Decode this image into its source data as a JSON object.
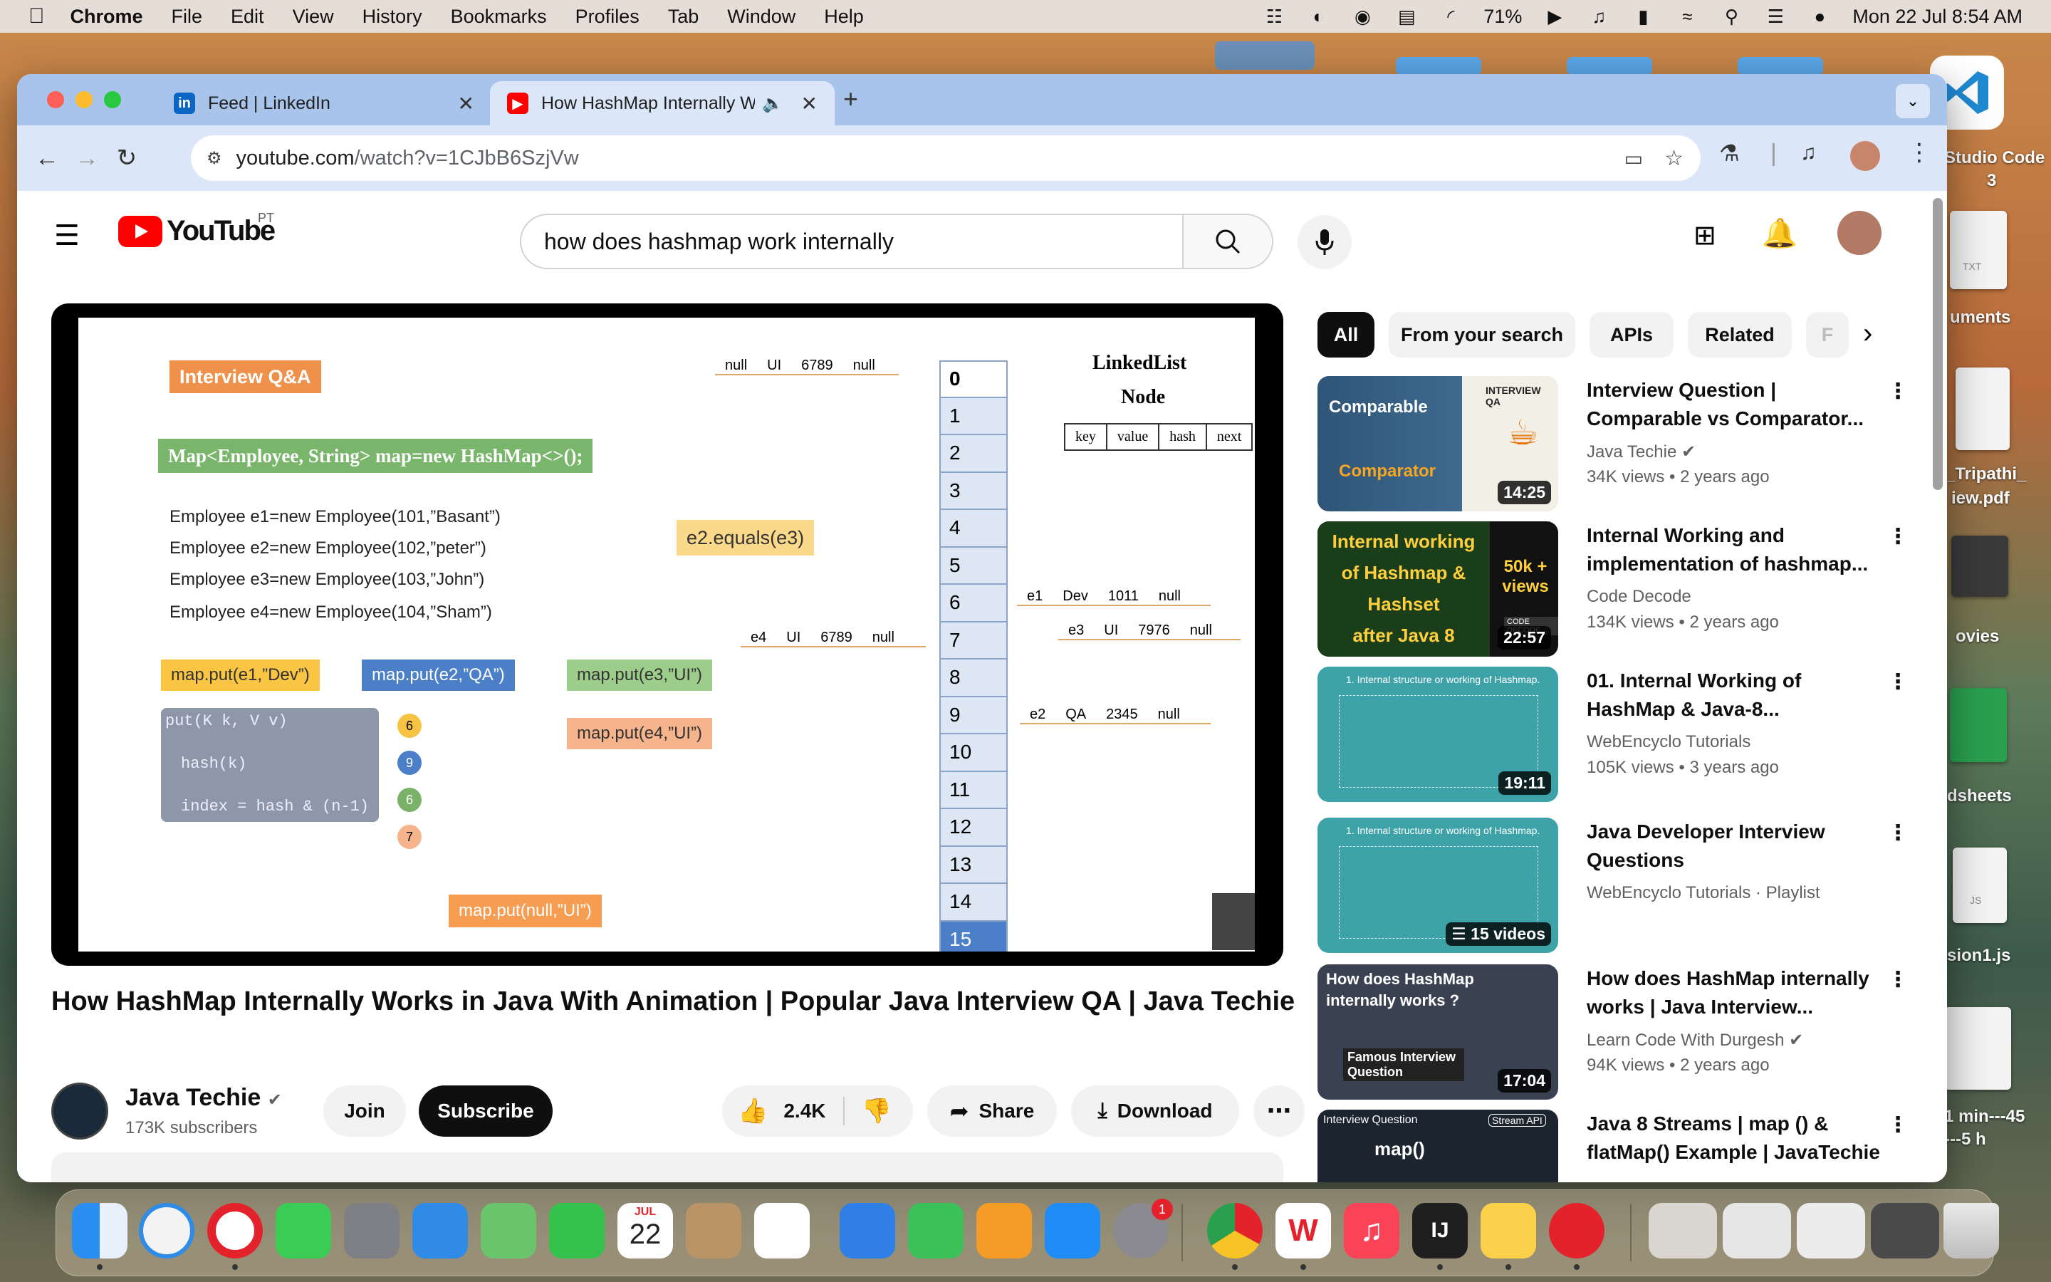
{
  "menubar": {
    "app_name": "Chrome",
    "menus": [
      "File",
      "Edit",
      "View",
      "History",
      "Bookmarks",
      "Profiles",
      "Tab",
      "Window",
      "Help"
    ],
    "battery_percent": "71%",
    "datetime": "Mon 22 Jul  8:54 AM"
  },
  "desktop": {
    "labels": [
      "Studio Code",
      "3",
      "uments",
      "_Tripathi_",
      "iew.pdf",
      "ovies",
      "dsheets",
      "sion1.js",
      "1 min---45",
      "---5 h"
    ],
    "file_tags": [
      "TXT",
      "JS"
    ]
  },
  "browser": {
    "tabs": [
      {
        "label": "Feed | LinkedIn",
        "icon": "linkedin-icon",
        "active": false
      },
      {
        "label": "How HashMap Internally W",
        "icon": "youtube-icon",
        "active": true
      }
    ],
    "url_host": "youtube.com",
    "url_path": "/watch?v=1CJbB6SzjVw"
  },
  "youtube": {
    "logo_text": "YouTube",
    "region": "PT",
    "search_value": "how does hashmap work internally",
    "video": {
      "slide": {
        "tag": "Interview Q&A",
        "declaration": "Map<Employee, String> map=new HashMap<>();",
        "code_lines": [
          "Employee e1=new Employee(101,”Basant”)",
          "Employee e2=new Employee(102,”peter”)",
          "Employee e3=new Employee(103,”John”)",
          "Employee e4=new Employee(104,”Sham”)"
        ],
        "equals_box": "e2.equals(e3)",
        "put_calls": [
          "map.put(e1,”Dev”)",
          "map.put(e2,”QA”)",
          "map.put(e3,”UI”)",
          "map.put(e4,”UI”)",
          "map.put(null,”UI”)"
        ],
        "method_lines": [
          "put(K k, V v)",
          "hash(k)",
          "index = hash & (n-1)"
        ],
        "circle_numbers": [
          "6",
          "9",
          "6",
          "7"
        ],
        "buckets": [
          "0",
          "1",
          "2",
          "3",
          "4",
          "5",
          "6",
          "7",
          "8",
          "9",
          "10",
          "11",
          "12",
          "13",
          "14",
          "15"
        ],
        "linked_list_title": "LinkedList",
        "node_title": "Node",
        "node_fields": [
          "key",
          "value",
          "hash",
          "next"
        ],
        "node_rows": [
          {
            "label": "",
            "key": "null",
            "value": "UI",
            "hash": "6789",
            "next": "null"
          },
          {
            "label": "e1",
            "key": "",
            "value": "Dev",
            "hash": "1011",
            "next": "null"
          },
          {
            "label": "e3",
            "key": "",
            "value": "UI",
            "hash": "7976",
            "next": "null"
          },
          {
            "label": "e4",
            "key": "",
            "value": "UI",
            "hash": "6789",
            "next": "null"
          },
          {
            "label": "e2",
            "key": "",
            "value": "QA",
            "hash": "2345",
            "next": "null"
          }
        ]
      }
    },
    "title": "How HashMap Internally Works in Java With Animation | Popular Java Interview QA | Java Techie",
    "channel": {
      "name": "Java Techie",
      "subscribers": "173K subscribers",
      "join_label": "Join",
      "subscribe_label": "Subscribe"
    },
    "actions": {
      "likes": "2.4K",
      "share_label": "Share",
      "download_label": "Download"
    },
    "chips": [
      "All",
      "From your search",
      "APIs",
      "Related",
      "F"
    ],
    "recommendations": [
      {
        "title": "Interview Question | Comparable vs Comparator...",
        "channel": "Java Techie",
        "verified": true,
        "views": "34K views",
        "age": "2 years ago",
        "duration": "14:25"
      },
      {
        "title": "Internal Working and implementation of hashmap...",
        "channel": "Code Decode",
        "verified": false,
        "views": "134K views",
        "age": "2 years ago",
        "duration": "22:57"
      },
      {
        "title": "01. Internal Working of HashMap & Java-8...",
        "channel": "WebEncyclo Tutorials",
        "verified": false,
        "views": "105K views",
        "age": "3 years ago",
        "duration": "19:11"
      },
      {
        "title": "Java Developer Interview Questions",
        "channel": "WebEncyclo Tutorials · Playlist",
        "verified": false,
        "views": "",
        "age": "",
        "duration": "15 videos"
      },
      {
        "title": "How does HashMap internally works | Java Interview...",
        "channel": "Learn Code With Durgesh",
        "verified": true,
        "views": "94K views",
        "age": "2 years ago",
        "duration": "17:04"
      },
      {
        "title": "Java 8 Streams | map () & flatMap() Example | JavaTechie",
        "channel": "",
        "verified": false,
        "views": "",
        "age": "",
        "duration": ""
      }
    ],
    "thumb_text": {
      "t1_top": "Comparable",
      "t1_bottom": "Comparator",
      "t1_tag": "INTERVIEW QA",
      "t2_lines": [
        "Internal working",
        "of Hashmap &",
        "Hashset",
        "after Java 8"
      ],
      "t2_badge": "50k + views",
      "t2_brand": "CODE DECODE",
      "t3_text": "1.   Internal structure or working of Hashmap.",
      "t5_title": "How does HashMap internally works ?",
      "t5_tag": "Famous Interview Question",
      "t6_left": "Interview Question",
      "t6_tag": "Stream API",
      "t6_main": "map()"
    }
  },
  "dock": {
    "calendar_month": "JUL",
    "calendar_day": "22",
    "settings_badge": "1"
  },
  "colors": {
    "youtube_red": "#ff0000",
    "tab_bar": "#a9c4ea",
    "toolbar": "#dbe7f8"
  }
}
